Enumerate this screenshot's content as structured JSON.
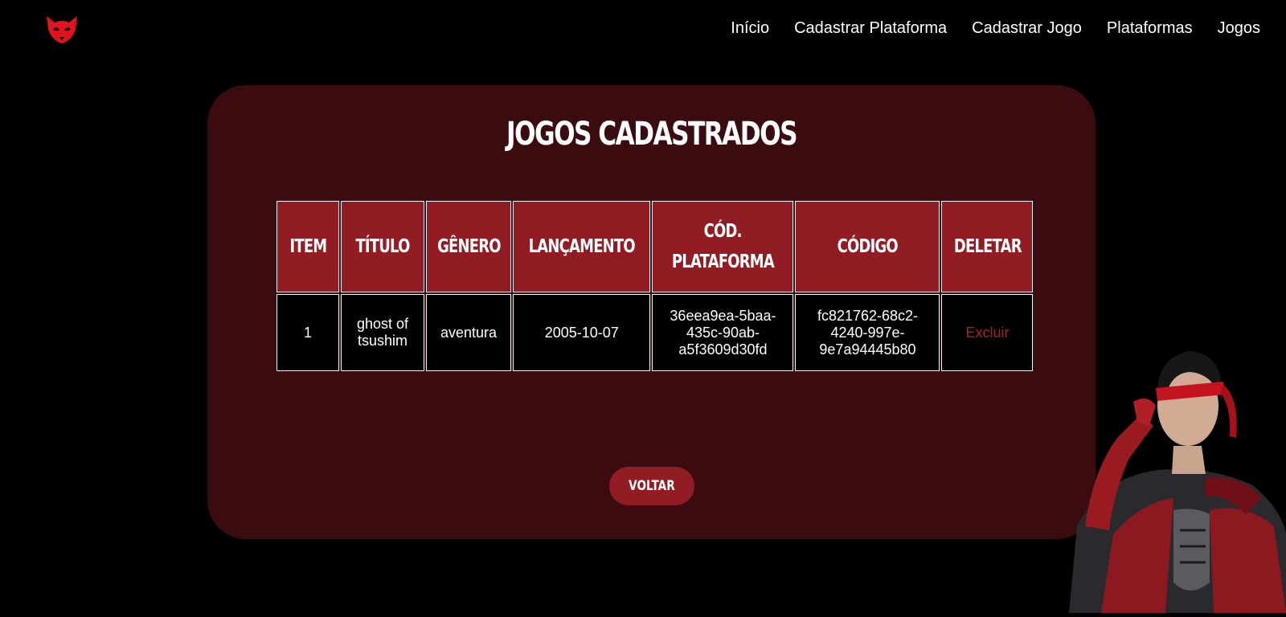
{
  "nav": {
    "items": [
      "Início",
      "Cadastrar Plataforma",
      "Cadastrar Jogo",
      "Plataformas",
      "Jogos"
    ]
  },
  "page": {
    "title": "JOGOS CADASTRADOS",
    "back_button": "VOLTAR"
  },
  "table": {
    "headers": {
      "item": "ITEM",
      "titulo": "TÍTULO",
      "genero": "GÊNERO",
      "lancamento": "LANÇAMENTO",
      "cod_plataforma_1": "CÓD.",
      "cod_plataforma_2": "PLATAFORMA",
      "codigo": "CÓDIGO",
      "deletar": "DELETAR"
    },
    "rows": [
      {
        "item": "1",
        "titulo_1": "ghost of",
        "titulo_2": "tsushim",
        "genero": "aventura",
        "lancamento": "2005-10-07",
        "cod_plataforma_1": "36eea9ea-5baa-",
        "cod_plataforma_2": "435c-90ab-",
        "cod_plataforma_3": "a5f3609d30fd",
        "codigo_1": "fc821762-68c2-",
        "codigo_2": "4240-997e-",
        "codigo_3": "9e7a94445b80",
        "acao": "Excluir"
      }
    ]
  },
  "colors": {
    "background": "#000000",
    "panel": "#3a0c10",
    "accent": "#921c24",
    "delete_link": "#b01e26",
    "logo": "#e0141e"
  },
  "icons": {
    "logo": "fox-mask-logo",
    "hero": "red-ninja-character"
  }
}
